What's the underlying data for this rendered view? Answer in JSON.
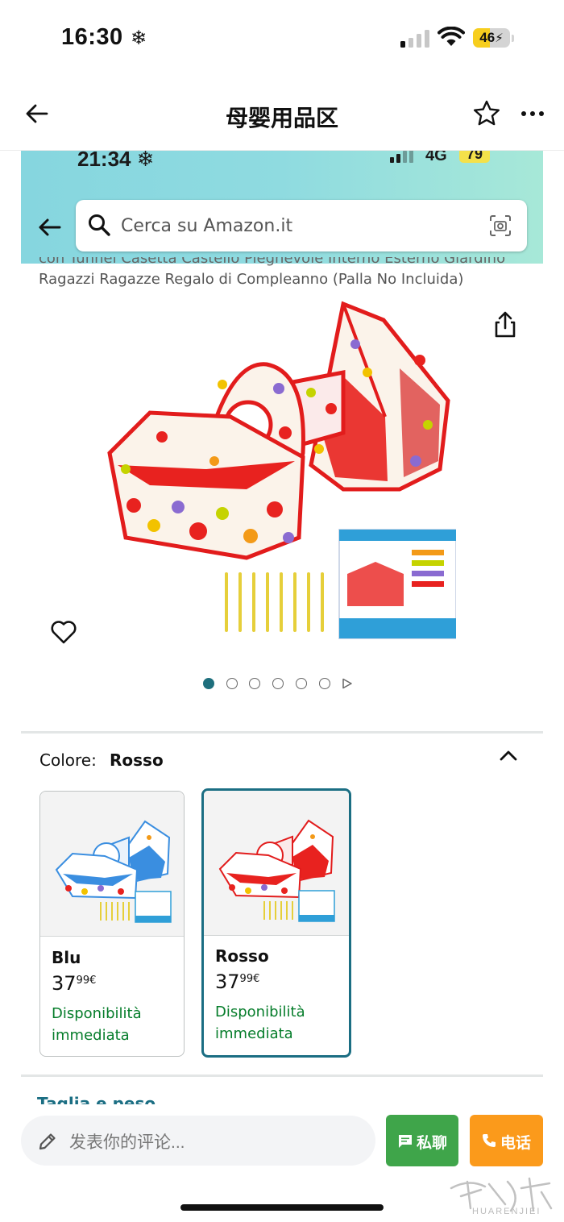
{
  "status_bar": {
    "time": "16:30",
    "time_icon": "snowflake-icon",
    "battery": "46",
    "battery_level": 0.46
  },
  "nav": {
    "title": "母婴用品区",
    "back_icon": "back-arrow-icon",
    "favorite_icon": "star-icon",
    "more_icon": "more-icon"
  },
  "embedded": {
    "status": {
      "time": "21:34",
      "network": "4G",
      "battery": "79"
    },
    "search_placeholder": "Cerca su Amazon.it",
    "title_line1": "con Tunnel Casetta Castello Pieghevole Interno Esterno Giardino",
    "title_line2": "Ragazzi Ragazze Regalo di Compleanno (Palla No Incluida)",
    "image_pages": 6,
    "image_active_page": 1,
    "color_label": "Colore:",
    "color_value": "Rosso",
    "options": [
      {
        "name": "Blu",
        "price_int": "37",
        "price_dec": "99",
        "currency": "€",
        "availability_line1": "Disponibilità",
        "availability_line2": "immediata",
        "selected": false
      },
      {
        "name": "Rosso",
        "price_int": "37",
        "price_dec": "99",
        "currency": "€",
        "availability_line1": "Disponibilità",
        "availability_line2": "immediata",
        "selected": true
      }
    ],
    "next_section": "Taglia e peso"
  },
  "bottom_bar": {
    "comment_placeholder": "发表你的评论...",
    "chat_label": "私聊",
    "call_label": "电话"
  },
  "watermark": {
    "text": "HUARENJIEI"
  },
  "colors": {
    "accent_teal": "#1b6e83",
    "chat_green": "#3fa54a",
    "call_orange": "#fb9a1b",
    "availability_green": "#067d2b",
    "battery_yellow": "#f7ce1e"
  }
}
